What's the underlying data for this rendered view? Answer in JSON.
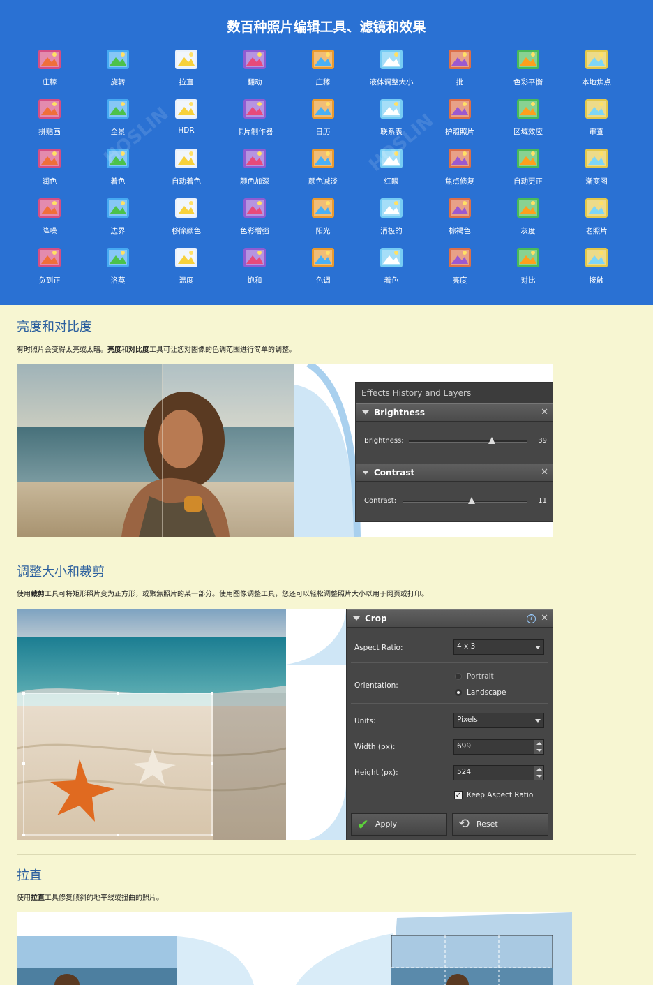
{
  "header": {
    "title": "数百种照片编辑工具、滤镜和效果"
  },
  "tools": [
    [
      "庄稼",
      "旋转",
      "拉直",
      "翻动",
      "庄稼",
      "液体调整大小",
      "批",
      "色彩平衡",
      "本地焦点"
    ],
    [
      "拼贴画",
      "全景",
      "HDR",
      "卡片制作器",
      "日历",
      "联系表",
      "护照照片",
      "区域效应",
      "审查"
    ],
    [
      "润色",
      "着色",
      "自动着色",
      "颜色加深",
      "颜色减淡",
      "红眼",
      "焦点修复",
      "自动更正",
      "渐变图"
    ],
    [
      "降噪",
      "边界",
      "移除颜色",
      "色彩增强",
      "阳光",
      "消极的",
      "棕褐色",
      "灰度",
      "老照片"
    ],
    [
      "负到正",
      "洛莫",
      "温度",
      "饱和",
      "色调",
      "着色",
      "亮度",
      "对比",
      "接触"
    ]
  ],
  "icons": [
    [
      "crop-icon",
      "rotate-icon",
      "straighten-icon",
      "flip-icon",
      "crop-expand-icon",
      "liquid-resize-icon",
      "batch-icon",
      "color-balance-icon",
      "local-focus-icon"
    ],
    [
      "collage-icon",
      "panorama-icon",
      "hdr-icon",
      "card-maker-icon",
      "calendar-icon",
      "contact-sheet-icon",
      "passport-photo-icon",
      "area-effect-icon",
      "censor-icon"
    ],
    [
      "retouch-icon",
      "colorize-icon",
      "auto-colorize-icon",
      "burn-icon",
      "dodge-icon",
      "red-eye-icon",
      "focus-fix-icon",
      "auto-correct-icon",
      "gradient-map-icon"
    ],
    [
      "denoise-icon",
      "border-icon",
      "remove-color-icon",
      "color-boost-icon",
      "sunshine-icon",
      "negative-icon",
      "sepia-icon",
      "grayscale-icon",
      "old-photo-icon"
    ],
    [
      "negative-to-positive-icon",
      "lomo-icon",
      "temperature-icon",
      "saturation-icon",
      "hue-icon",
      "tint-icon",
      "brightness-icon",
      "contrast-icon",
      "exposure-icon"
    ]
  ],
  "sections": {
    "brightness": {
      "title": "亮度和对比度",
      "desc_1": "有时照片会变得太亮或太暗。",
      "desc_b1": "亮度",
      "desc_2": "和",
      "desc_b2": "对比度",
      "desc_3": "工具可让您对图像的色调范围进行简单的调整。"
    },
    "crop": {
      "title": "调整大小和裁剪",
      "desc_1": "使用",
      "desc_b1": "裁剪",
      "desc_2": "工具可将矩形照片变为正方形，或聚焦照片的某一部分。使用图像调整工具，您还可以轻松调整照片大小以用于网页或打印。"
    },
    "straighten": {
      "title": "拉直",
      "desc_1": "使用",
      "desc_b1": "拉直",
      "desc_2": "工具修复倾斜的地平线或扭曲的照片。"
    }
  },
  "effects_panel": {
    "title": "Effects History and Layers",
    "brightness": {
      "header": "Brightness",
      "label": "Brightness:",
      "value": "39",
      "fraction": 0.7
    },
    "contrast": {
      "header": "Contrast",
      "label": "Contrast:",
      "value": "11",
      "fraction": 0.55
    }
  },
  "crop_panel": {
    "header": "Crop",
    "aspect_label": "Aspect Ratio:",
    "aspect_value": "4 x 3",
    "orientation_label": "Orientation:",
    "portrait": "Portrait",
    "landscape": "Landscape",
    "units_label": "Units:",
    "units_value": "Pixels",
    "width_label": "Width (px):",
    "width_value": "699",
    "height_label": "Height (px):",
    "height_value": "524",
    "keep_aspect": "Keep Aspect Ratio",
    "apply": "Apply",
    "reset": "Reset"
  },
  "colors": {
    "header_bg": "#2a71d3",
    "page_bg": "#f7f6d2",
    "heading": "#2b5f9e",
    "panel": "#464646"
  }
}
